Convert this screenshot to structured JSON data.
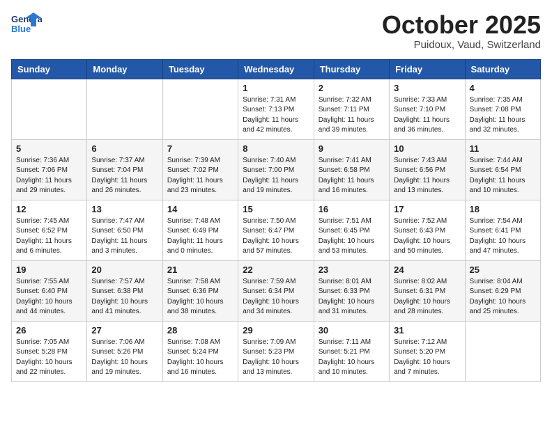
{
  "header": {
    "logo_general": "General",
    "logo_blue": "Blue",
    "month_title": "October 2025",
    "location": "Puidoux, Vaud, Switzerland"
  },
  "weekdays": [
    "Sunday",
    "Monday",
    "Tuesday",
    "Wednesday",
    "Thursday",
    "Friday",
    "Saturday"
  ],
  "weeks": [
    [
      {
        "day": "",
        "sunrise": "",
        "sunset": "",
        "daylight": ""
      },
      {
        "day": "",
        "sunrise": "",
        "sunset": "",
        "daylight": ""
      },
      {
        "day": "",
        "sunrise": "",
        "sunset": "",
        "daylight": ""
      },
      {
        "day": "1",
        "sunrise": "Sunrise: 7:31 AM",
        "sunset": "Sunset: 7:13 PM",
        "daylight": "Daylight: 11 hours and 42 minutes."
      },
      {
        "day": "2",
        "sunrise": "Sunrise: 7:32 AM",
        "sunset": "Sunset: 7:11 PM",
        "daylight": "Daylight: 11 hours and 39 minutes."
      },
      {
        "day": "3",
        "sunrise": "Sunrise: 7:33 AM",
        "sunset": "Sunset: 7:10 PM",
        "daylight": "Daylight: 11 hours and 36 minutes."
      },
      {
        "day": "4",
        "sunrise": "Sunrise: 7:35 AM",
        "sunset": "Sunset: 7:08 PM",
        "daylight": "Daylight: 11 hours and 32 minutes."
      }
    ],
    [
      {
        "day": "5",
        "sunrise": "Sunrise: 7:36 AM",
        "sunset": "Sunset: 7:06 PM",
        "daylight": "Daylight: 11 hours and 29 minutes."
      },
      {
        "day": "6",
        "sunrise": "Sunrise: 7:37 AM",
        "sunset": "Sunset: 7:04 PM",
        "daylight": "Daylight: 11 hours and 26 minutes."
      },
      {
        "day": "7",
        "sunrise": "Sunrise: 7:39 AM",
        "sunset": "Sunset: 7:02 PM",
        "daylight": "Daylight: 11 hours and 23 minutes."
      },
      {
        "day": "8",
        "sunrise": "Sunrise: 7:40 AM",
        "sunset": "Sunset: 7:00 PM",
        "daylight": "Daylight: 11 hours and 19 minutes."
      },
      {
        "day": "9",
        "sunrise": "Sunrise: 7:41 AM",
        "sunset": "Sunset: 6:58 PM",
        "daylight": "Daylight: 11 hours and 16 minutes."
      },
      {
        "day": "10",
        "sunrise": "Sunrise: 7:43 AM",
        "sunset": "Sunset: 6:56 PM",
        "daylight": "Daylight: 11 hours and 13 minutes."
      },
      {
        "day": "11",
        "sunrise": "Sunrise: 7:44 AM",
        "sunset": "Sunset: 6:54 PM",
        "daylight": "Daylight: 11 hours and 10 minutes."
      }
    ],
    [
      {
        "day": "12",
        "sunrise": "Sunrise: 7:45 AM",
        "sunset": "Sunset: 6:52 PM",
        "daylight": "Daylight: 11 hours and 6 minutes."
      },
      {
        "day": "13",
        "sunrise": "Sunrise: 7:47 AM",
        "sunset": "Sunset: 6:50 PM",
        "daylight": "Daylight: 11 hours and 3 minutes."
      },
      {
        "day": "14",
        "sunrise": "Sunrise: 7:48 AM",
        "sunset": "Sunset: 6:49 PM",
        "daylight": "Daylight: 11 hours and 0 minutes."
      },
      {
        "day": "15",
        "sunrise": "Sunrise: 7:50 AM",
        "sunset": "Sunset: 6:47 PM",
        "daylight": "Daylight: 10 hours and 57 minutes."
      },
      {
        "day": "16",
        "sunrise": "Sunrise: 7:51 AM",
        "sunset": "Sunset: 6:45 PM",
        "daylight": "Daylight: 10 hours and 53 minutes."
      },
      {
        "day": "17",
        "sunrise": "Sunrise: 7:52 AM",
        "sunset": "Sunset: 6:43 PM",
        "daylight": "Daylight: 10 hours and 50 minutes."
      },
      {
        "day": "18",
        "sunrise": "Sunrise: 7:54 AM",
        "sunset": "Sunset: 6:41 PM",
        "daylight": "Daylight: 10 hours and 47 minutes."
      }
    ],
    [
      {
        "day": "19",
        "sunrise": "Sunrise: 7:55 AM",
        "sunset": "Sunset: 6:40 PM",
        "daylight": "Daylight: 10 hours and 44 minutes."
      },
      {
        "day": "20",
        "sunrise": "Sunrise: 7:57 AM",
        "sunset": "Sunset: 6:38 PM",
        "daylight": "Daylight: 10 hours and 41 minutes."
      },
      {
        "day": "21",
        "sunrise": "Sunrise: 7:58 AM",
        "sunset": "Sunset: 6:36 PM",
        "daylight": "Daylight: 10 hours and 38 minutes."
      },
      {
        "day": "22",
        "sunrise": "Sunrise: 7:59 AM",
        "sunset": "Sunset: 6:34 PM",
        "daylight": "Daylight: 10 hours and 34 minutes."
      },
      {
        "day": "23",
        "sunrise": "Sunrise: 8:01 AM",
        "sunset": "Sunset: 6:33 PM",
        "daylight": "Daylight: 10 hours and 31 minutes."
      },
      {
        "day": "24",
        "sunrise": "Sunrise: 8:02 AM",
        "sunset": "Sunset: 6:31 PM",
        "daylight": "Daylight: 10 hours and 28 minutes."
      },
      {
        "day": "25",
        "sunrise": "Sunrise: 8:04 AM",
        "sunset": "Sunset: 6:29 PM",
        "daylight": "Daylight: 10 hours and 25 minutes."
      }
    ],
    [
      {
        "day": "26",
        "sunrise": "Sunrise: 7:05 AM",
        "sunset": "Sunset: 5:28 PM",
        "daylight": "Daylight: 10 hours and 22 minutes."
      },
      {
        "day": "27",
        "sunrise": "Sunrise: 7:06 AM",
        "sunset": "Sunset: 5:26 PM",
        "daylight": "Daylight: 10 hours and 19 minutes."
      },
      {
        "day": "28",
        "sunrise": "Sunrise: 7:08 AM",
        "sunset": "Sunset: 5:24 PM",
        "daylight": "Daylight: 10 hours and 16 minutes."
      },
      {
        "day": "29",
        "sunrise": "Sunrise: 7:09 AM",
        "sunset": "Sunset: 5:23 PM",
        "daylight": "Daylight: 10 hours and 13 minutes."
      },
      {
        "day": "30",
        "sunrise": "Sunrise: 7:11 AM",
        "sunset": "Sunset: 5:21 PM",
        "daylight": "Daylight: 10 hours and 10 minutes."
      },
      {
        "day": "31",
        "sunrise": "Sunrise: 7:12 AM",
        "sunset": "Sunset: 5:20 PM",
        "daylight": "Daylight: 10 hours and 7 minutes."
      },
      {
        "day": "",
        "sunrise": "",
        "sunset": "",
        "daylight": ""
      }
    ]
  ]
}
